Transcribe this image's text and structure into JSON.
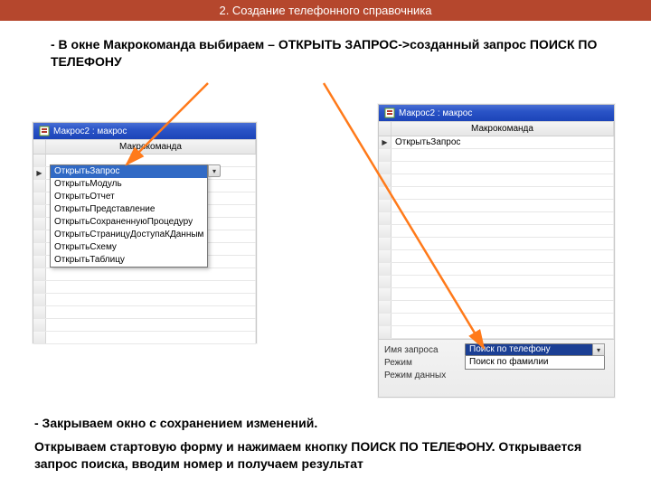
{
  "banner": "2. Создание телефонного справочника",
  "instruction1": " - В окне Макрокоманда выбираем – ОТКРЫТЬ ЗАПРОС->созданный запрос ПОИСК ПО ТЕЛЕФОНУ",
  "left": {
    "title": "Макрос2 : макрос",
    "column": "Макрокоманда",
    "dropdown_selected": "ОткрытьЗапрос",
    "dropdown": [
      "ОткрытьЗапрос",
      "ОткрытьМодуль",
      "ОткрытьОтчет",
      "ОткрытьПредставление",
      "ОткрытьСохраненнуюПроцедуру",
      "ОткрытьСтраницуДоступаКДанным",
      "ОткрытьСхему",
      "ОткрытьТаблицу"
    ]
  },
  "right": {
    "title": "Макрос2 : макрос",
    "column": "Макрокоманда",
    "value": "ОткрытьЗапрос",
    "props": {
      "label1": "Имя запроса",
      "label2": "Режим",
      "label3": "Режим данных"
    },
    "select_selected": "Поиск по телефону",
    "select_alt": "Поиск по фамилии"
  },
  "instruction2": "- Закрываем окно с сохранением изменений.",
  "instruction3": "Открываем стартовую форму и нажимаем кнопку ПОИСК ПО ТЕЛЕФОНУ. Открывается запрос поиска, вводим номер и получаем результат"
}
